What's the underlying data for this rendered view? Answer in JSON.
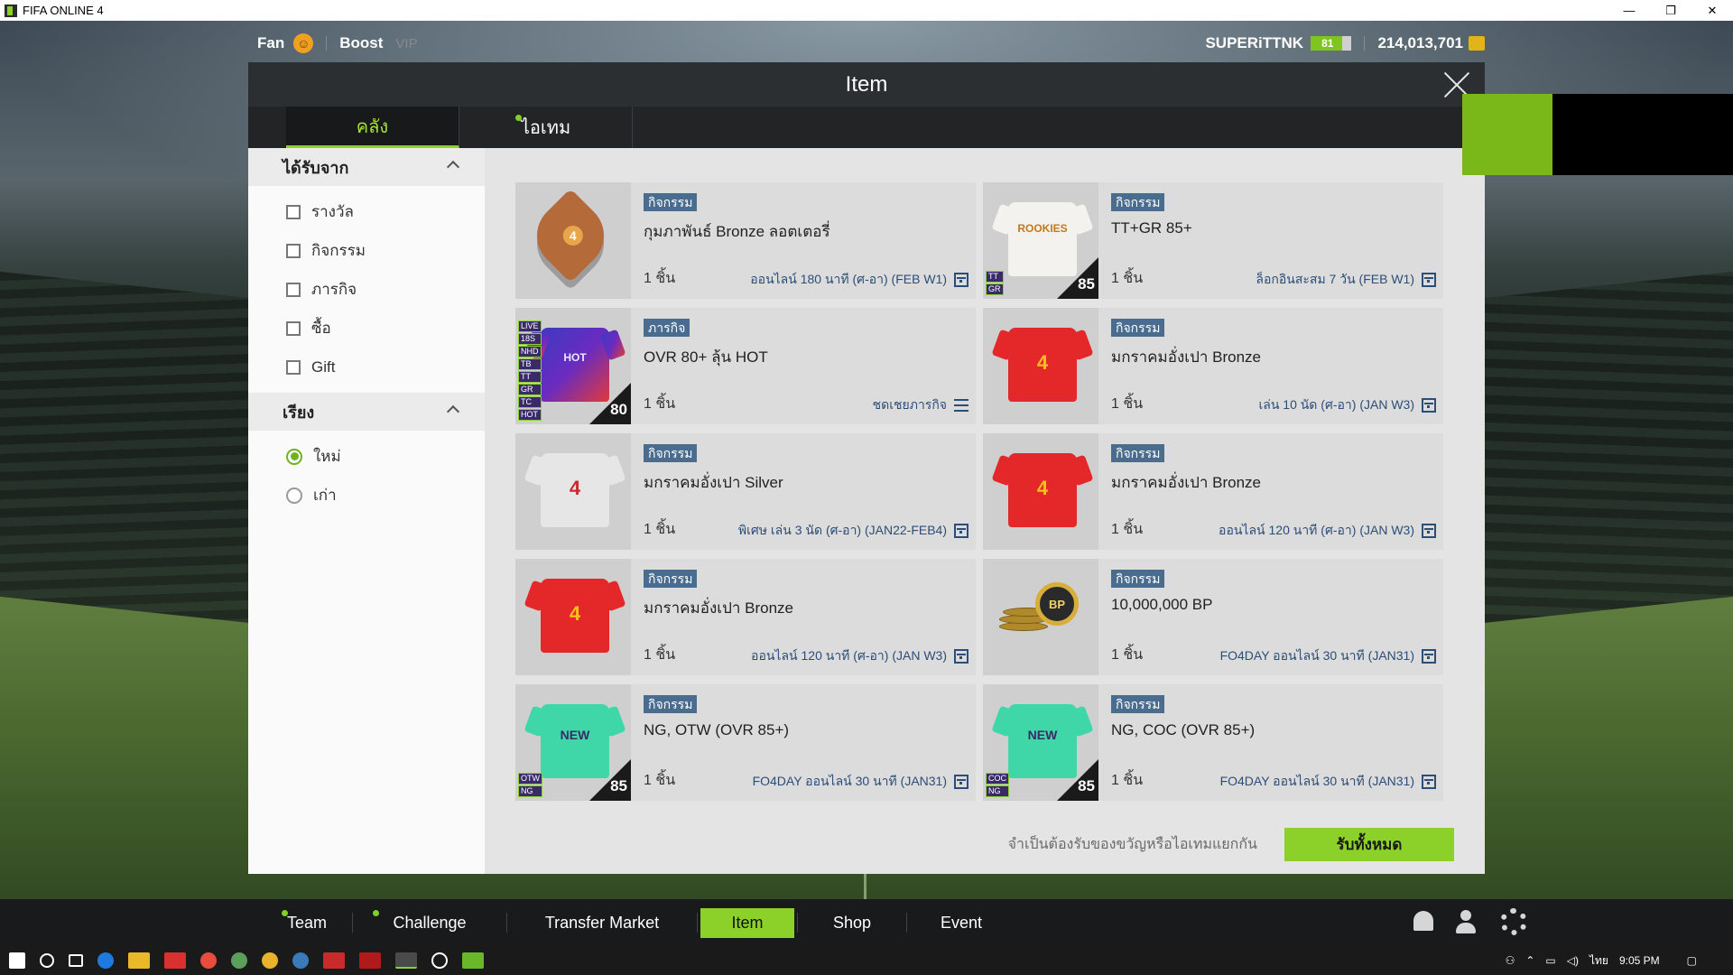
{
  "window": {
    "title": "FIFA ONLINE 4",
    "controls": [
      "—",
      "❐",
      "✕"
    ]
  },
  "topbar": {
    "fan_label": "Fan",
    "boost_label": "Boost",
    "vip_label": "VIP",
    "username": "SUPERiTTNK",
    "level": "81",
    "currency": "214,013,701"
  },
  "modal": {
    "title": "Item",
    "tabs": [
      {
        "label": "คลัง"
      },
      {
        "label": "ไอเทม"
      }
    ],
    "filters": {
      "source_title": "ได้รับจาก",
      "source_options": [
        "รางวัล",
        "กิจกรรม",
        "ภารกิจ",
        "ซื้อ",
        "Gift"
      ],
      "sort_title": "เรียง",
      "sort_options": [
        "ใหม่",
        "เก่า"
      ],
      "sort_selected": "ใหม่"
    },
    "items": [
      {
        "badge": "กิจกรรม",
        "name": "กุมภาพันธ์ Bronze ลอตเตอรี่",
        "qty": "1 ชิ้น",
        "condition": "ออนไลน์ 180 นาที (ศ-อา) (FEB W1)",
        "thumb": "heart",
        "cond_icon": "calendar-icon"
      },
      {
        "badge": "กิจกรรม",
        "name": "TT+GR 85+",
        "qty": "1 ชิ้น",
        "condition": "ล็อกอินสะสม 7 วัน (FEB W1)",
        "thumb": "shirt-white",
        "ovr": "85",
        "tags": [
          "TT",
          "GR"
        ],
        "shirt_text": "ROOKIES",
        "cond_icon": "calendar-icon"
      },
      {
        "badge": "ภารกิจ",
        "name": "OVR 80+ ลุ้น HOT",
        "qty": "1 ชิ้น",
        "condition": "ชดเชยภารกิจ",
        "thumb": "shirt-purple",
        "ovr": "80",
        "tags": [
          "LIVE",
          "18S",
          "NHD",
          "TB",
          "TT",
          "GR",
          "TC",
          "HOT"
        ],
        "shirt_text": "HOT",
        "cond_icon": "list-icon"
      },
      {
        "badge": "กิจกรรม",
        "name": "มกราคมอั่งเปา Bronze",
        "qty": "1 ชิ้น",
        "condition": "เล่น 10 นัด (ศ-อา) (JAN W3)",
        "thumb": "shirt-red",
        "shirt_text": "4",
        "cond_icon": "calendar-icon"
      },
      {
        "badge": "กิจกรรม",
        "name": "มกราคมอั่งเปา Silver",
        "qty": "1 ชิ้น",
        "condition": "พิเศษ เล่น 3 นัด (ศ-อา) (JAN22-FEB4)",
        "thumb": "shirt-silver",
        "shirt_text": "4",
        "cond_icon": "calendar-icon"
      },
      {
        "badge": "กิจกรรม",
        "name": "มกราคมอั่งเปา Bronze",
        "qty": "1 ชิ้น",
        "condition": "ออนไลน์ 120 นาที (ศ-อา) (JAN W3)",
        "thumb": "shirt-red",
        "shirt_text": "4",
        "cond_icon": "calendar-icon"
      },
      {
        "badge": "กิจกรรม",
        "name": "มกราคมอั่งเปา Bronze",
        "qty": "1 ชิ้น",
        "condition": "ออนไลน์ 120 นาที (ศ-อา) (JAN W3)",
        "thumb": "shirt-red",
        "shirt_text": "4",
        "cond_icon": "calendar-icon"
      },
      {
        "badge": "กิจกรรม",
        "name": "10,000,000 BP",
        "qty": "1 ชิ้น",
        "condition": "FO4DAY ออนไลน์ 30 นาที (JAN31)",
        "thumb": "coins",
        "coin_text": "BP",
        "cond_icon": "calendar-icon"
      },
      {
        "badge": "กิจกรรม",
        "name": "NG, OTW (OVR 85+)",
        "qty": "1 ชิ้น",
        "condition": "FO4DAY ออนไลน์ 30 นาที (JAN31)",
        "thumb": "shirt-teal",
        "ovr": "85",
        "tags": [
          "OTW",
          "NG"
        ],
        "shirt_text": "NEW",
        "cond_icon": "calendar-icon"
      },
      {
        "badge": "กิจกรรม",
        "name": "NG, COC (OVR 85+)",
        "qty": "1 ชิ้น",
        "condition": "FO4DAY ออนไลน์ 30 นาที (JAN31)",
        "thumb": "shirt-teal",
        "ovr": "85",
        "tags": [
          "COC",
          "NG"
        ],
        "shirt_text": "NEW",
        "cond_icon": "calendar-icon"
      }
    ],
    "footer": {
      "note": "จำเป็นต้องรับของขวัญหรือไอเทมแยกกัน",
      "claim_all": "รับทั้งหมด"
    }
  },
  "bottom_nav": [
    {
      "label": "Team",
      "dot": true
    },
    {
      "label": "Challenge",
      "dot": true
    },
    {
      "label": "Transfer Market",
      "dot": false
    },
    {
      "label": "Item",
      "dot": false,
      "active": true
    },
    {
      "label": "Shop",
      "dot": false
    },
    {
      "label": "Event",
      "dot": false
    }
  ],
  "taskbar": {
    "time": "9:05 PM",
    "lang": "ไทย"
  },
  "colors": {
    "accent": "#8cd12a",
    "badge": "#4a6d8f",
    "link": "#2b4d78"
  }
}
